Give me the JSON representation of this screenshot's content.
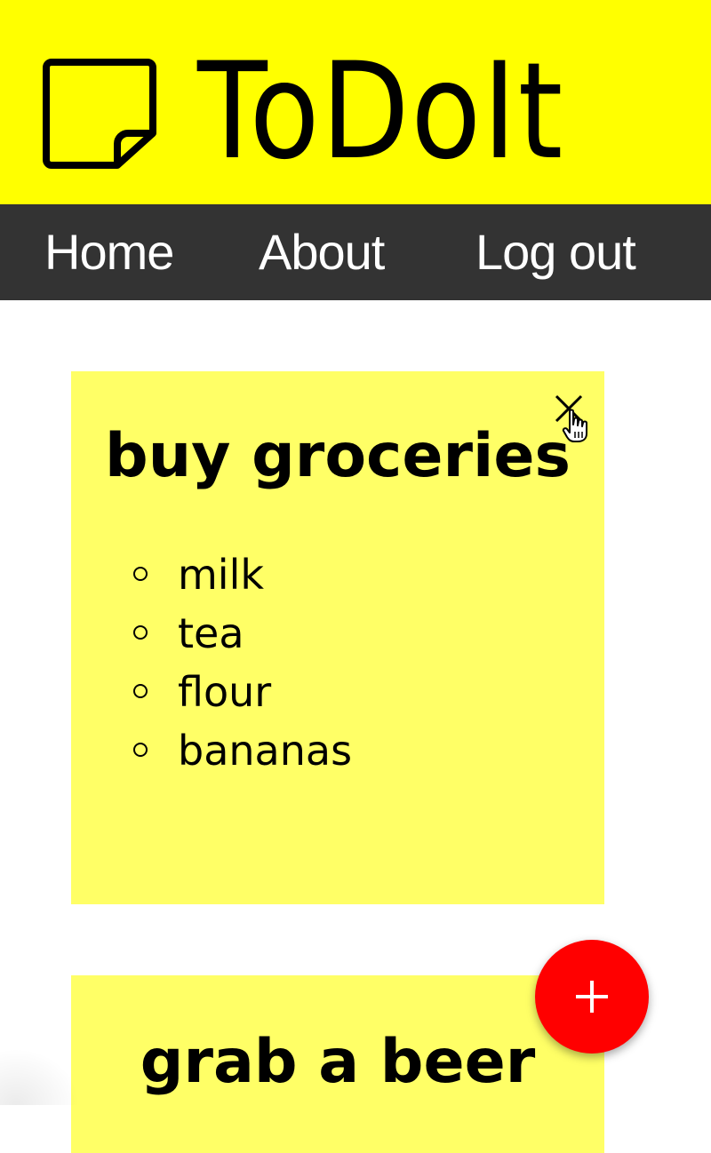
{
  "app": {
    "title": "ToDoIt",
    "logo_icon": "sticky-note-icon",
    "header_color": "#ffff00"
  },
  "nav": {
    "items": [
      {
        "label": "Home"
      },
      {
        "label": "About"
      },
      {
        "label": "Log out"
      }
    ],
    "background": "#333333"
  },
  "notes": [
    {
      "title": "buy groceries",
      "items": [
        "milk",
        "tea",
        "flour",
        "bananas"
      ],
      "close_icon": "close-icon",
      "color": "#ffff66"
    },
    {
      "title": "grab a beer",
      "items": [],
      "color": "#ffff66"
    }
  ],
  "fab": {
    "icon": "plus-icon",
    "color": "#ff0000"
  }
}
